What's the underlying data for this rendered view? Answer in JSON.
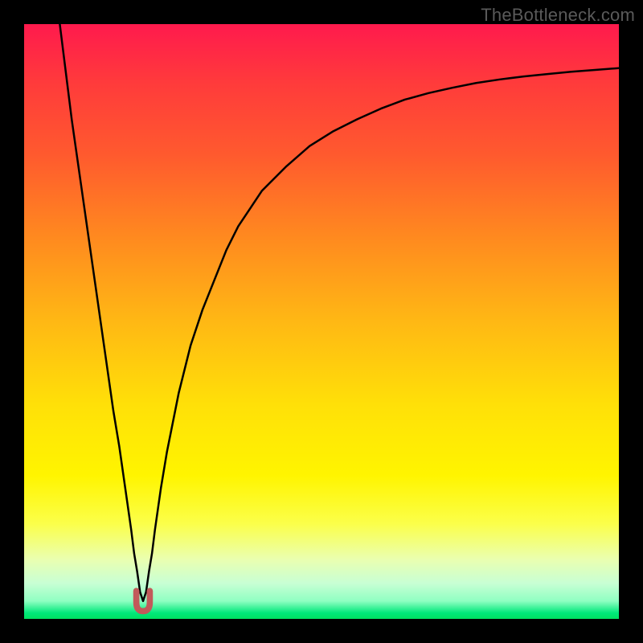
{
  "watermark": "TheBottleneck.com",
  "chart_data": {
    "type": "line",
    "title": "",
    "subtitle": "",
    "xlabel": "",
    "ylabel": "",
    "xlim": [
      0,
      100
    ],
    "ylim": [
      0,
      100
    ],
    "grid": false,
    "legend": false,
    "x_of_min": 20,
    "background_gradient_stops": [
      {
        "pct": 0,
        "color": "#ff1a4d"
      },
      {
        "pct": 10,
        "color": "#ff3b3b"
      },
      {
        "pct": 22,
        "color": "#ff5a2e"
      },
      {
        "pct": 36,
        "color": "#ff8a1f"
      },
      {
        "pct": 50,
        "color": "#ffb814"
      },
      {
        "pct": 64,
        "color": "#ffe008"
      },
      {
        "pct": 76,
        "color": "#fff500"
      },
      {
        "pct": 84,
        "color": "#fbff4a"
      },
      {
        "pct": 90,
        "color": "#eaffb0"
      },
      {
        "pct": 94,
        "color": "#c8ffd4"
      },
      {
        "pct": 97,
        "color": "#8fffc2"
      },
      {
        "pct": 99,
        "color": "#00e87a"
      },
      {
        "pct": 100,
        "color": "#00e060"
      }
    ],
    "series": [
      {
        "name": "bottleneck-curve",
        "color": "#000000",
        "stroke_width": 2.5,
        "x": [
          6,
          7,
          8,
          9,
          10,
          11,
          12,
          13,
          14,
          15,
          16,
          17,
          18,
          18.5,
          19,
          19.5,
          20,
          20.5,
          21,
          21.5,
          22,
          23,
          24,
          25,
          26,
          27,
          28,
          30,
          32,
          34,
          36,
          38,
          40,
          44,
          48,
          52,
          56,
          60,
          64,
          68,
          72,
          76,
          80,
          84,
          88,
          92,
          96,
          100
        ],
        "y": [
          100,
          92,
          84,
          77,
          70,
          63,
          56,
          49,
          42,
          35,
          29,
          22,
          15,
          11,
          8,
          4.5,
          3,
          4.5,
          8,
          11,
          15,
          22,
          28,
          33,
          38,
          42,
          46,
          52,
          57,
          62,
          66,
          69,
          72,
          76,
          79.5,
          82,
          84,
          85.8,
          87.3,
          88.4,
          89.3,
          90.1,
          90.7,
          91.2,
          91.6,
          92,
          92.3,
          92.6
        ]
      }
    ],
    "markers": [
      {
        "name": "min-marker",
        "color": "#c25a5a",
        "x": 20,
        "y": 3,
        "shape": "U",
        "approx_radius_px": 14
      }
    ]
  }
}
